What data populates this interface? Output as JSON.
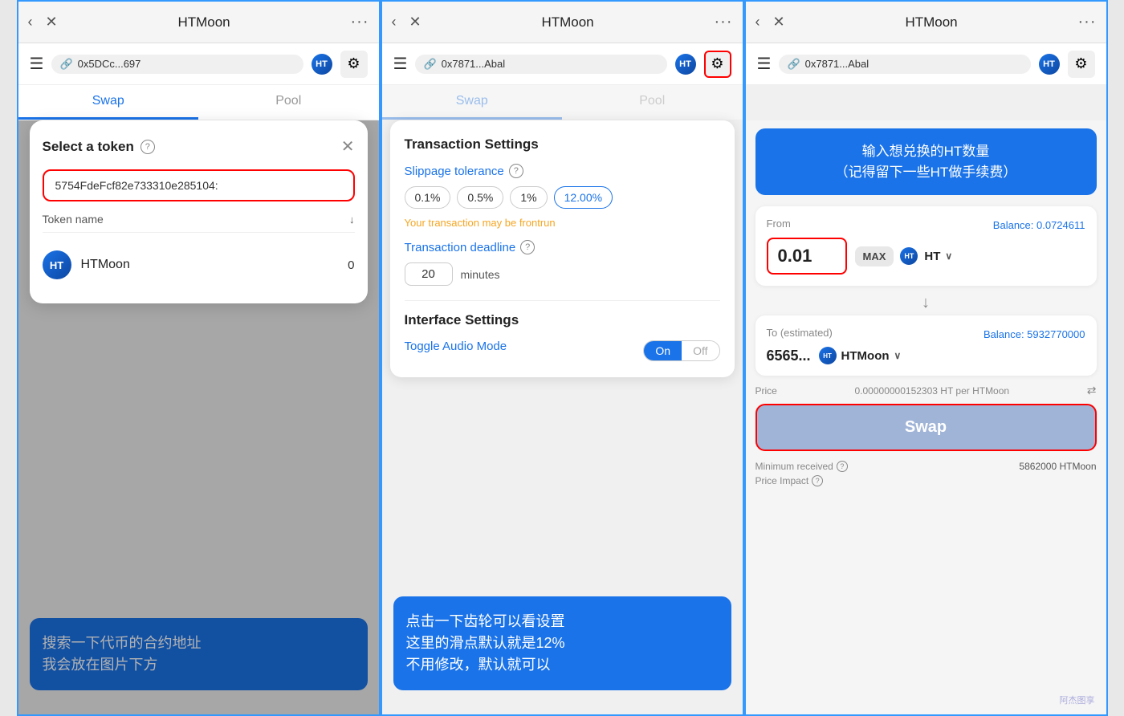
{
  "panel1": {
    "browser_back": "‹",
    "browser_close": "✕",
    "browser_title": "HTMoon",
    "browser_more": "···",
    "header_address": "0x5DCc...697",
    "header_settings_label": "⚙",
    "tab_swap": "Swap",
    "tab_pool": "Pool",
    "modal_title": "Select a token",
    "help_icon": "?",
    "close_modal": "✕",
    "search_placeholder": "5754FdeFcf82e733310e285104:",
    "token_sort_label": "Token name",
    "token_sort_arrow": "↓",
    "token1_name": "HTMoon",
    "token1_balance": "0",
    "annotation_line1": "搜索一下代币的合约地址",
    "annotation_line2": "我会放在图片下方"
  },
  "panel2": {
    "browser_back": "‹",
    "browser_close": "✕",
    "browser_title": "HTMoon",
    "browser_more": "···",
    "header_address": "0x7871...Abal",
    "settings_title": "Transaction Settings",
    "slippage_label": "Slippage tolerance",
    "slippage_options": [
      "0.1%",
      "0.5%",
      "1%",
      "12.00%"
    ],
    "warning_text": "Your transaction may be frontrun",
    "deadline_label": "Transaction deadline",
    "deadline_value": "20",
    "deadline_unit": "minutes",
    "interface_title": "Interface Settings",
    "toggle_audio_label": "Toggle Audio Mode",
    "toggle_on": "On",
    "toggle_off": "Off",
    "annotation_line1": "点击一下齿轮可以看设置",
    "annotation_line2": "这里的滑点默认就是12%",
    "annotation_line3": "不用修改，默认就可以"
  },
  "panel3": {
    "browser_back": "‹",
    "browser_close": "✕",
    "browser_title": "HTMoon",
    "browser_more": "···",
    "header_address": "0x7871...Abal",
    "header_box_text": "输入想兑换的HT数量\n（记得留下一些HT做手续费）",
    "from_label": "From",
    "balance_label": "Balance: 0.0724611",
    "amount_value": "0.01",
    "max_btn": "MAX",
    "from_token": "HT",
    "arrow_down": "↓",
    "to_label": "To (estimated)",
    "to_balance": "Balance: 5932770000",
    "to_amount": "6565...",
    "to_token": "HTMoon",
    "price_label": "Price",
    "price_value": "0.00000000152303 HT per\nHTMoon",
    "swap_btn": "Swap",
    "min_received_label": "Minimum received",
    "min_received_value": "5862000 HTMoon",
    "price_impact_label": "Price Impact",
    "watermark": "阿杰图享"
  },
  "icons": {
    "link": "🔗",
    "gear": "⚙",
    "hamburger": "☰",
    "chevron_down": "∨",
    "refresh": "⇄",
    "help": "?"
  }
}
